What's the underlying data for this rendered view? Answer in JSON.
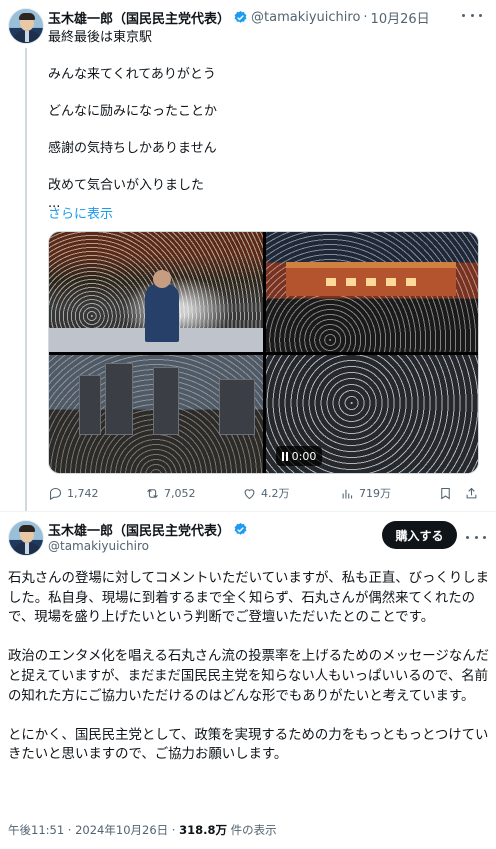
{
  "parent_tweet": {
    "display_name": "玉木雄一郎（国民民主党代表）",
    "handle": "@tamakiyuichiro",
    "separator": "·",
    "date": "10月26日",
    "text_lines": [
      "最終最後は東京駅",
      "",
      "みんな来てくれてありがとう",
      "",
      "どんなに励みになったことか",
      "",
      "感謝の気持ちしかありません",
      "",
      "改めて気合いが入りました",
      "..."
    ],
    "show_more": "さらに表示",
    "video_time": "0:00",
    "stats": {
      "replies": "1,742",
      "reposts": "7,052",
      "likes": "4.2万",
      "views": "719万"
    }
  },
  "main_tweet": {
    "display_name": "玉木雄一郎（国民民主党代表）",
    "handle": "@tamakiyuichiro",
    "buy_button": "購入する",
    "paragraphs": [
      "石丸さんの登場に対してコメントいただいていますが、私も正直、びっくりしました。私自身、現場に到着するまで全く知らず、石丸さんが偶然来てくれたので、現場を盛り上げたいという判断でご登壇いただいたとのことです。",
      "政治のエンタメ化を唱える石丸さん流の投票率を上げるためのメッセージなんだと捉えていますが、まだまだ国民民主党を知らない人もいっぱいいるので、名前の知れた方にご協力いただけるのはどんな形でもありがたいと考えています。",
      "とにかく、国民民主党として、政策を実現するための力をもっともっとつけていきたいと思いますので、ご協力お願いします。"
    ],
    "timestamp": "午後11:51 · 2024年10月26日 · ",
    "view_count": "318.8万",
    "view_suffix": " 件の表示"
  },
  "colors": {
    "link_blue": "#1d9bf0",
    "verified_blue": "#1d9bf0",
    "muted_gray": "#536471",
    "button_black": "#0f1419"
  }
}
